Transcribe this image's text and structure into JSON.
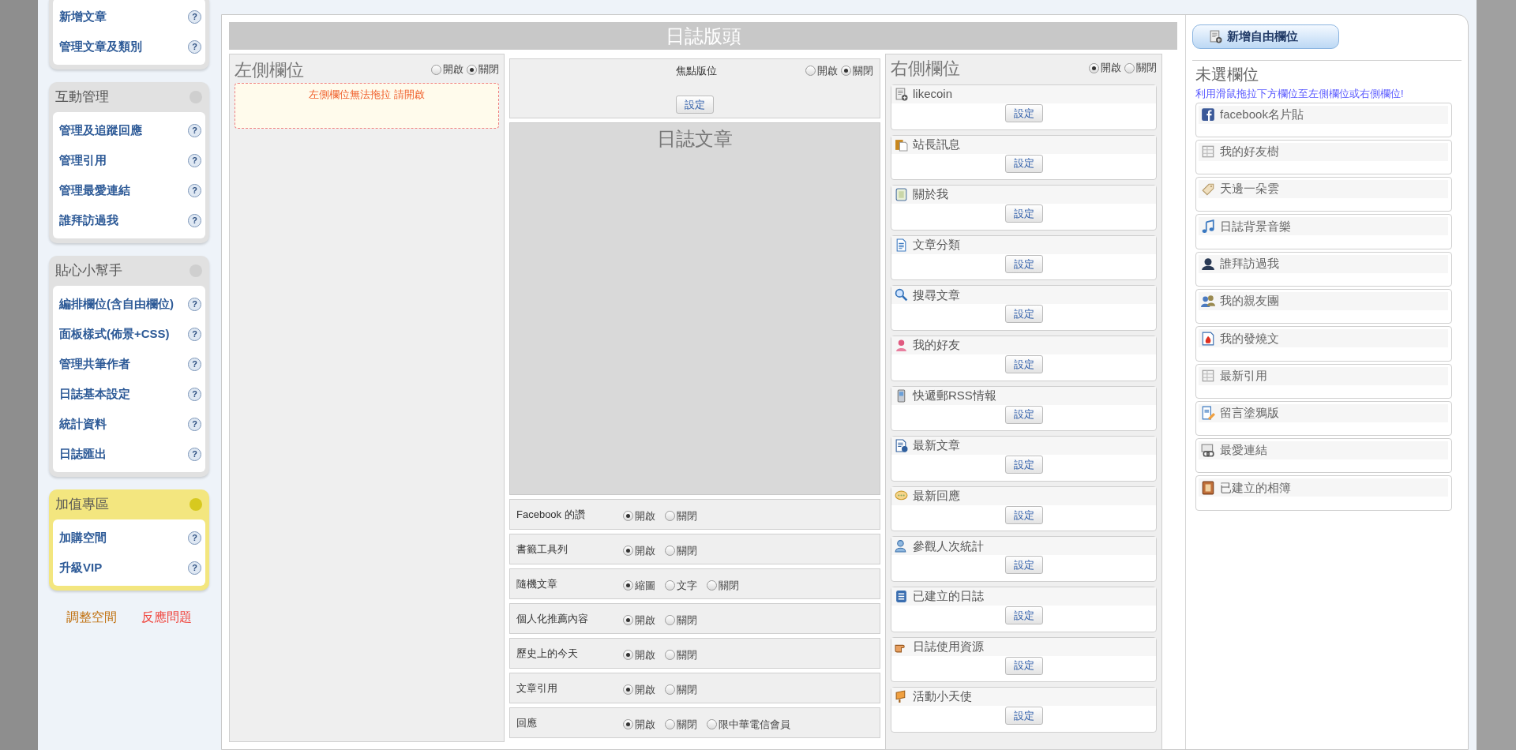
{
  "sidebar": {
    "sections": [
      {
        "kind": "plain",
        "items": [
          {
            "label": "新增文章",
            "help": "?"
          },
          {
            "label": "管理文章及類別",
            "help": "?"
          }
        ]
      },
      {
        "kind": "normal",
        "title": "互動管理",
        "items": [
          {
            "label": "管理及追蹤回應",
            "help": "?"
          },
          {
            "label": "管理引用",
            "help": "?"
          },
          {
            "label": "管理最愛連結",
            "help": "?"
          },
          {
            "label": "誰拜訪過我",
            "help": "?"
          }
        ]
      },
      {
        "kind": "normal",
        "title": "貼心小幫手",
        "items": [
          {
            "label": "編排欄位(含自由欄位)",
            "help": "?"
          },
          {
            "label": "面板樣式(佈景+CSS)",
            "help": "?"
          },
          {
            "label": "管理共筆作者",
            "help": "?"
          },
          {
            "label": "日誌基本設定",
            "help": "?"
          },
          {
            "label": "統計資料",
            "help": "?"
          },
          {
            "label": "日誌匯出",
            "help": "?"
          }
        ]
      },
      {
        "kind": "premium",
        "title": "加值專區",
        "items": [
          {
            "label": "加購空間",
            "help": "?"
          },
          {
            "label": "升級VIP",
            "help": "?"
          }
        ]
      }
    ],
    "footer_links": [
      {
        "label": "調整空間",
        "color": "#c0700f"
      },
      {
        "label": "反應問題",
        "color": "#f0443c"
      }
    ]
  },
  "header_title": "日誌版頭",
  "left_column": {
    "title": "左側欄位",
    "options": [
      {
        "label": "開啟",
        "selected": false
      },
      {
        "label": "關閉",
        "selected": true
      }
    ],
    "notice": "左側欄位無法拖拉 請開啟"
  },
  "focus_slot": {
    "title": "焦點版位",
    "options": [
      {
        "label": "開啟",
        "selected": false
      },
      {
        "label": "關閉",
        "selected": true
      }
    ],
    "button": "設定"
  },
  "article_area": {
    "title": "日誌文章"
  },
  "settings": [
    {
      "label": "Facebook 的讚",
      "options": [
        {
          "label": "開啟",
          "selected": true
        },
        {
          "label": "關閉",
          "selected": false
        }
      ]
    },
    {
      "label": "書籤工具列",
      "options": [
        {
          "label": "開啟",
          "selected": true
        },
        {
          "label": "關閉",
          "selected": false
        }
      ]
    },
    {
      "label": "隨機文章",
      "options": [
        {
          "label": "縮圖",
          "selected": true
        },
        {
          "label": "文字",
          "selected": false
        },
        {
          "label": "關閉",
          "selected": false
        }
      ]
    },
    {
      "label": "個人化推薦內容",
      "options": [
        {
          "label": "開啟",
          "selected": true
        },
        {
          "label": "關閉",
          "selected": false
        }
      ]
    },
    {
      "label": "歷史上的今天",
      "options": [
        {
          "label": "開啟",
          "selected": true
        },
        {
          "label": "關閉",
          "selected": false
        }
      ]
    },
    {
      "label": "文章引用",
      "options": [
        {
          "label": "開啟",
          "selected": true
        },
        {
          "label": "關閉",
          "selected": false
        }
      ]
    },
    {
      "label": "回應",
      "options": [
        {
          "label": "開啟",
          "selected": true
        },
        {
          "label": "關閉",
          "selected": false
        },
        {
          "label": "限中華電信會員",
          "selected": false
        }
      ]
    }
  ],
  "right_column": {
    "title": "右側欄位",
    "options": [
      {
        "label": "開啟",
        "selected": true
      },
      {
        "label": "關閉",
        "selected": false
      }
    ],
    "widgets": [
      {
        "label": "likecoin",
        "button": "設定"
      },
      {
        "label": "站長訊息",
        "button": "設定"
      },
      {
        "label": "關於我",
        "button": "設定"
      },
      {
        "label": "文章分類",
        "button": "設定"
      },
      {
        "label": "搜尋文章",
        "button": "設定"
      },
      {
        "label": "我的好友",
        "button": "設定"
      },
      {
        "label": "快遞郵RSS情報",
        "button": "設定"
      },
      {
        "label": "最新文章",
        "button": "設定"
      },
      {
        "label": "最新回應",
        "button": "設定"
      },
      {
        "label": "參觀人次統計",
        "button": "設定"
      },
      {
        "label": "已建立的日誌",
        "button": "設定"
      },
      {
        "label": "日誌使用資源",
        "button": "設定"
      },
      {
        "label": "活動小天使",
        "button": "設定"
      }
    ]
  },
  "unused": {
    "add_button": "新增自由欄位",
    "title": "未選欄位",
    "hint": "利用滑鼠拖拉下方欄位至左側欄位或右側欄位!",
    "widgets": [
      {
        "label": "facebook名片貼"
      },
      {
        "label": "我的好友樹"
      },
      {
        "label": "天邊一朵雲"
      },
      {
        "label": "日誌背景音樂"
      },
      {
        "label": "誰拜訪過我"
      },
      {
        "label": "我的親友團"
      },
      {
        "label": "我的發燒文"
      },
      {
        "label": "最新引用"
      },
      {
        "label": "留言塗鴉版"
      },
      {
        "label": "最愛連結"
      },
      {
        "label": "已建立的相簿"
      }
    ]
  }
}
